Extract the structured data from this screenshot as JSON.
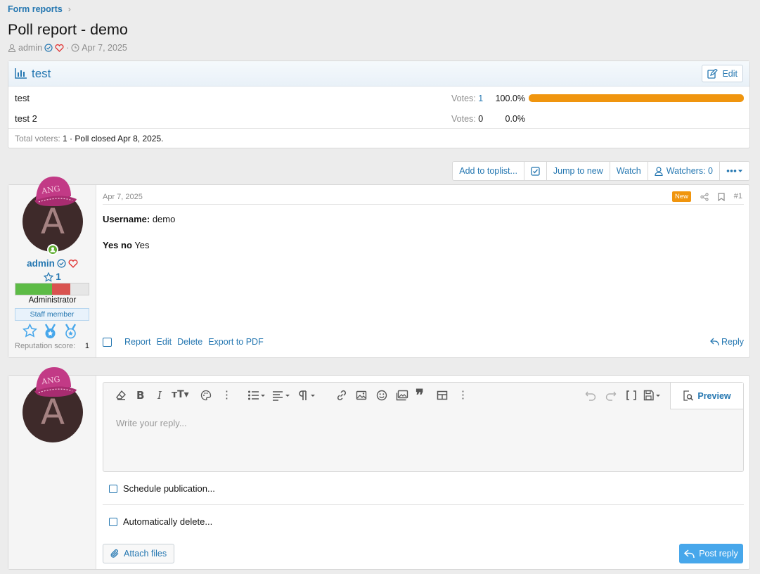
{
  "breadcrumb": {
    "item": "Form reports"
  },
  "thread": {
    "title": "Poll report - demo",
    "author": "admin",
    "date": "Apr 7, 2025"
  },
  "poll": {
    "title": "test",
    "edit_label": "Edit",
    "votes_label": "Votes:",
    "options": [
      {
        "text": "test",
        "votes": "1",
        "percent": "100.0%",
        "fraction": 1.0
      },
      {
        "text": "test 2",
        "votes": "0",
        "percent": "0.0%",
        "fraction": 0.0
      }
    ],
    "footer_label": "Total voters:",
    "footer_value": "1 · Poll closed Apr 8, 2025."
  },
  "actions": {
    "add_toplist": "Add to toplist...",
    "jump_new": "Jump to new",
    "watch": "Watch",
    "watchers": "Watchers: 0"
  },
  "post": {
    "date": "Apr 7, 2025",
    "new_badge": "New",
    "number": "#1",
    "user": {
      "avatar_letter": "A",
      "name": "admin",
      "stars": "1",
      "title": "Administrator",
      "badge": "Staff member",
      "rep_label": "Reputation score:",
      "rep_value": "1"
    },
    "field1_label": "Username:",
    "field1_value": "demo",
    "field2_label": "Yes no",
    "field2_value": "Yes",
    "footer": {
      "report": "Report",
      "edit": "Edit",
      "delete": "Delete",
      "export": "Export to PDF",
      "reply": "Reply"
    }
  },
  "reply": {
    "avatar_letter": "A",
    "placeholder": "Write your reply...",
    "preview": "Preview",
    "schedule": "Schedule publication...",
    "autodelete": "Automatically delete...",
    "attach": "Attach files",
    "post_reply": "Post reply"
  },
  "colors": {
    "accent": "#2577b1",
    "poll_bar": "#f0950e",
    "new_badge": "#f0950e",
    "post_button": "#47a7eb"
  }
}
